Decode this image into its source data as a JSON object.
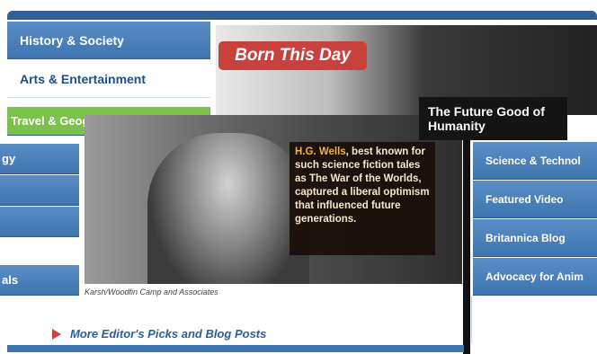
{
  "nav": {
    "items": [
      {
        "label": "History & Society"
      },
      {
        "label": "Arts & Entertainment"
      },
      {
        "label": "Travel & Geography"
      }
    ],
    "partial_items": [
      {
        "label": "gy"
      },
      {
        "label": ""
      },
      {
        "label": ""
      },
      {
        "label": "als"
      }
    ]
  },
  "feature": {
    "tab_label": "Born This Day",
    "headline": "The Future Good of Humanity",
    "caption": {
      "link_text": "H.G. Wells",
      "text": ", best known for such science fiction tales as The War of the Worlds, captured a liberal optimism that influenced future generations."
    },
    "photo_credit": "Karsh/Woodfin Camp and Associates"
  },
  "right_nav": {
    "items": [
      {
        "label": "Science & Technol"
      },
      {
        "label": "Featured Video"
      },
      {
        "label": "Britannica Blog"
      },
      {
        "label": "Advocacy for Anim"
      }
    ]
  },
  "more": {
    "label": "More Editor's Picks and Blog Posts"
  },
  "colors": {
    "nav_blue": "#3e74b0",
    "accent_red": "#c8413d",
    "accent_green": "#7cc14a"
  }
}
